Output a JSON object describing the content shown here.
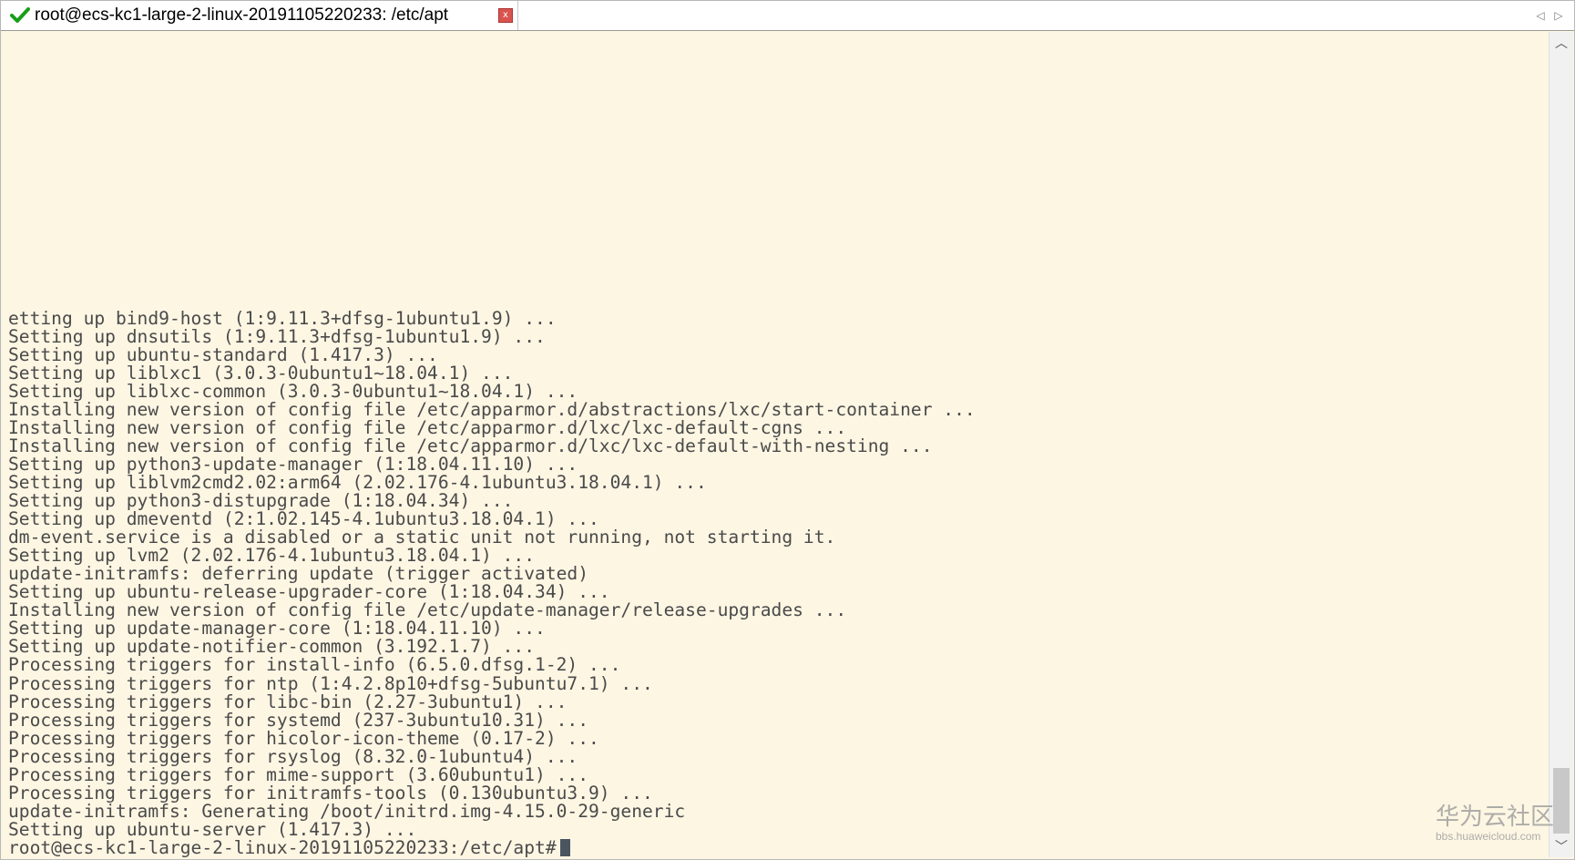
{
  "tab": {
    "title": "root@ecs-kc1-large-2-linux-20191105220233: /etc/apt",
    "close_label": "x",
    "status_icon": "check-icon",
    "status_color": "#1a9e1a"
  },
  "nav": {
    "left": "◁",
    "right": "▷"
  },
  "scrollbar": {
    "up": "︿",
    "down": "﹀"
  },
  "terminal": {
    "background": "#fdf6e3",
    "text_color": "#4a4a4a",
    "lines": [
      "etting up bind9-host (1:9.11.3+dfsg-1ubuntu1.9) ...",
      "Setting up dnsutils (1:9.11.3+dfsg-1ubuntu1.9) ...",
      "Setting up ubuntu-standard (1.417.3) ...",
      "Setting up liblxc1 (3.0.3-0ubuntu1~18.04.1) ...",
      "Setting up liblxc-common (3.0.3-0ubuntu1~18.04.1) ...",
      "Installing new version of config file /etc/apparmor.d/abstractions/lxc/start-container ...",
      "Installing new version of config file /etc/apparmor.d/lxc/lxc-default-cgns ...",
      "Installing new version of config file /etc/apparmor.d/lxc/lxc-default-with-nesting ...",
      "Setting up python3-update-manager (1:18.04.11.10) ...",
      "Setting up liblvm2cmd2.02:arm64 (2.02.176-4.1ubuntu3.18.04.1) ...",
      "Setting up python3-distupgrade (1:18.04.34) ...",
      "Setting up dmeventd (2:1.02.145-4.1ubuntu3.18.04.1) ...",
      "dm-event.service is a disabled or a static unit not running, not starting it.",
      "Setting up lvm2 (2.02.176-4.1ubuntu3.18.04.1) ...",
      "update-initramfs: deferring update (trigger activated)",
      "Setting up ubuntu-release-upgrader-core (1:18.04.34) ...",
      "Installing new version of config file /etc/update-manager/release-upgrades ...",
      "Setting up update-manager-core (1:18.04.11.10) ...",
      "Setting up update-notifier-common (3.192.1.7) ...",
      "Processing triggers for install-info (6.5.0.dfsg.1-2) ...",
      "Processing triggers for ntp (1:4.2.8p10+dfsg-5ubuntu7.1) ...",
      "Processing triggers for libc-bin (2.27-3ubuntu1) ...",
      "Processing triggers for systemd (237-3ubuntu10.31) ...",
      "Processing triggers for hicolor-icon-theme (0.17-2) ...",
      "Processing triggers for rsyslog (8.32.0-1ubuntu4) ...",
      "Processing triggers for mime-support (3.60ubuntu1) ...",
      "Processing triggers for initramfs-tools (0.130ubuntu3.9) ...",
      "update-initramfs: Generating /boot/initrd.img-4.15.0-29-generic",
      "Setting up ubuntu-server (1.417.3) ..."
    ],
    "prompt": "root@ecs-kc1-large-2-linux-20191105220233:/etc/apt#"
  },
  "watermark": {
    "main": "华为云社区",
    "sub": "bbs.huaweicloud.com"
  }
}
